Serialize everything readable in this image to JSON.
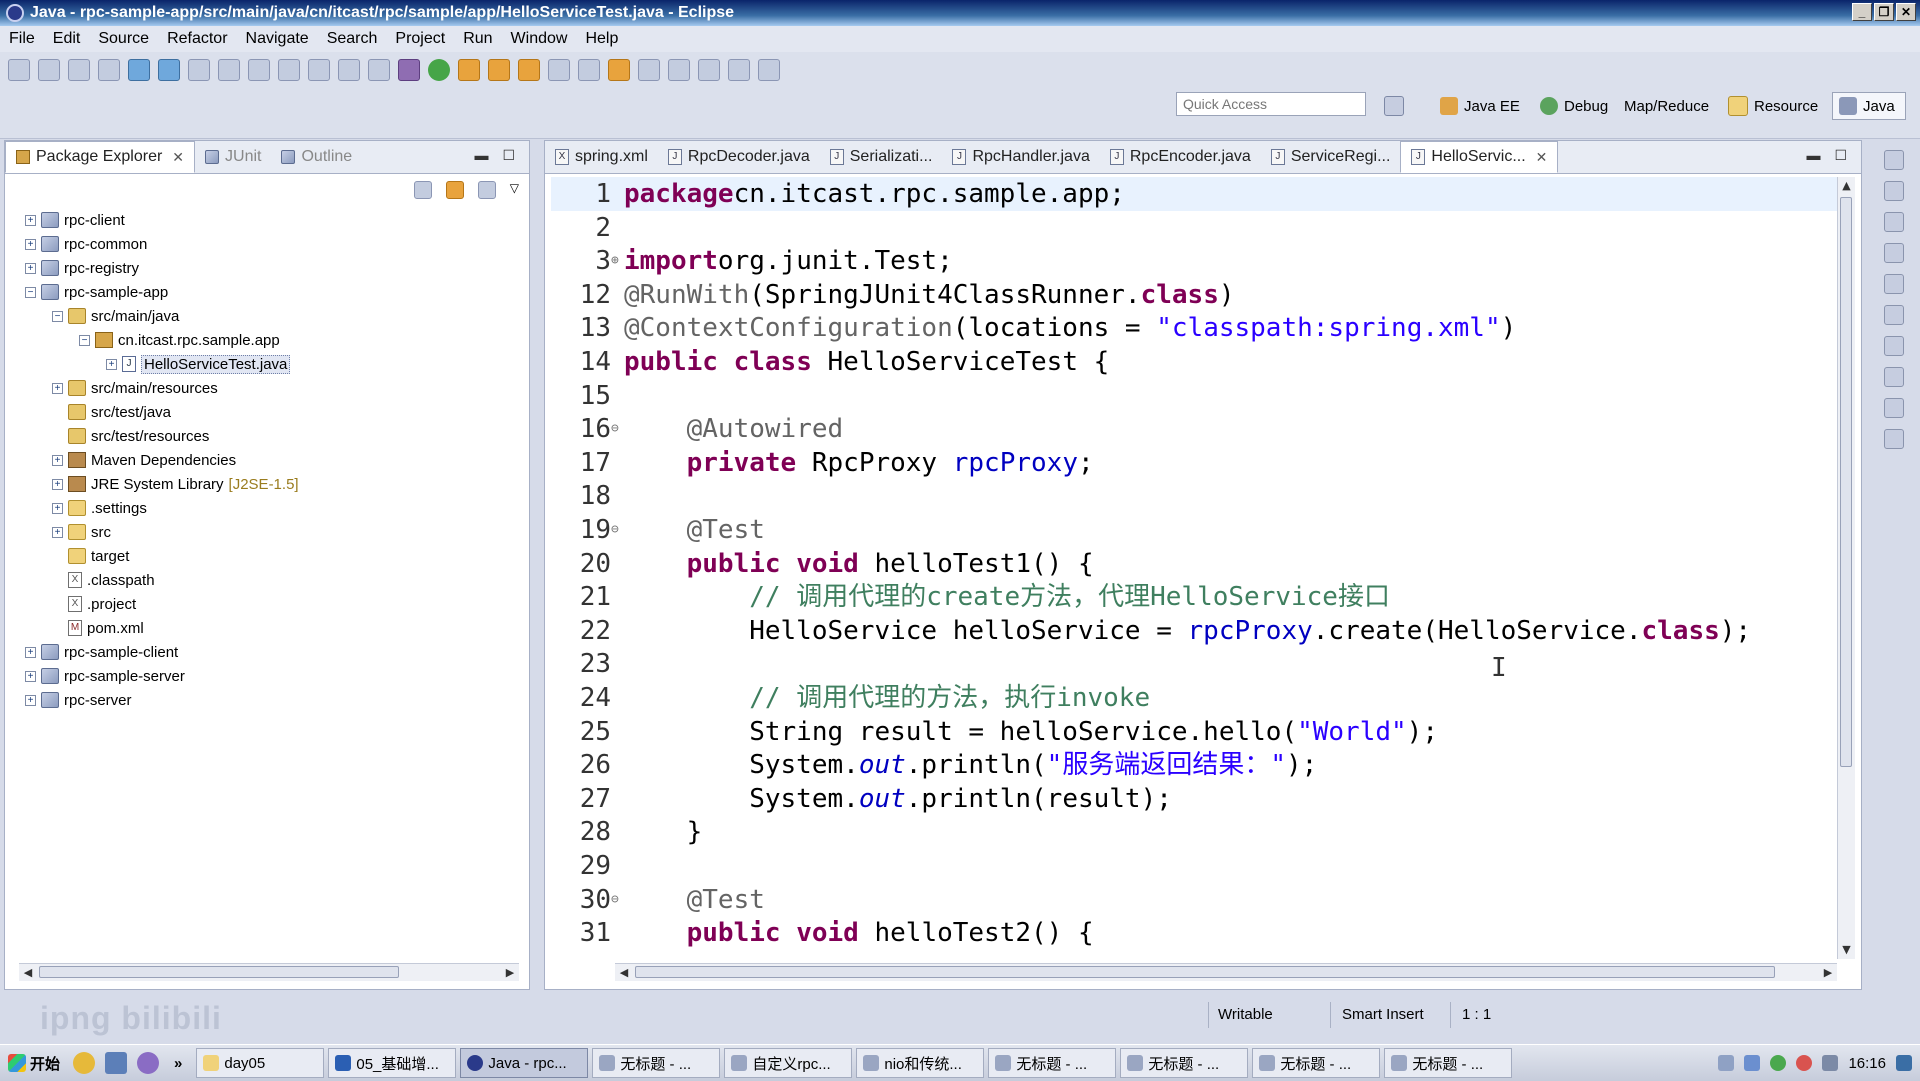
{
  "window": {
    "title": "Java - rpc-sample-app/src/main/java/cn/itcast/rpc/sample/app/HelloServiceTest.java - Eclipse",
    "buttons": [
      "_",
      "❐",
      "✕"
    ]
  },
  "menu": [
    "File",
    "Edit",
    "Source",
    "Refactor",
    "Navigate",
    "Search",
    "Project",
    "Run",
    "Window",
    "Help"
  ],
  "toolbar": {
    "quick_access_placeholder": "Quick Access",
    "perspectives": [
      "Java EE",
      "Debug",
      "Map/Reduce",
      "Resource",
      "Java"
    ]
  },
  "left_panel": {
    "tabs": [
      "Package Explorer",
      "JUnit",
      "Outline"
    ],
    "tree": [
      {
        "label": "rpc-client",
        "icon": "project-icon",
        "expander": "+"
      },
      {
        "label": "rpc-common",
        "icon": "project-icon",
        "expander": "+"
      },
      {
        "label": "rpc-registry",
        "icon": "project-icon",
        "expander": "+"
      },
      {
        "label": "rpc-sample-app",
        "icon": "project-icon",
        "expander": "−"
      },
      {
        "label": "src/main/java",
        "icon": "source-folder-icon",
        "expander": "−"
      },
      {
        "label": "cn.itcast.rpc.sample.app",
        "icon": "package-icon",
        "expander": "−"
      },
      {
        "label": "HelloServiceTest.java",
        "icon": "java-file-icon",
        "expander": "+"
      },
      {
        "label": "src/main/resources",
        "icon": "source-folder-icon",
        "expander": "+"
      },
      {
        "label": "src/test/java",
        "icon": "source-folder-icon",
        "expander": ""
      },
      {
        "label": "src/test/resources",
        "icon": "source-folder-icon",
        "expander": ""
      },
      {
        "label": "Maven Dependencies",
        "icon": "library-icon",
        "expander": "+"
      },
      {
        "label": "JRE System Library",
        "decoration": "[J2SE-1.5]",
        "icon": "library-icon",
        "expander": "+"
      },
      {
        "label": ".settings",
        "icon": "folder-icon",
        "expander": "+"
      },
      {
        "label": "src",
        "icon": "folder-icon",
        "expander": "+"
      },
      {
        "label": "target",
        "icon": "folder-icon",
        "expander": ""
      },
      {
        "label": ".classpath",
        "icon": "xml-file-icon",
        "expander": ""
      },
      {
        "label": ".project",
        "icon": "xml-file-icon",
        "expander": ""
      },
      {
        "label": "pom.xml",
        "icon": "maven-file-icon",
        "expander": ""
      },
      {
        "label": "rpc-sample-client",
        "icon": "project-icon",
        "expander": "+"
      },
      {
        "label": "rpc-sample-server",
        "icon": "project-icon",
        "expander": "+"
      },
      {
        "label": "rpc-server",
        "icon": "project-icon",
        "expander": "+"
      }
    ]
  },
  "editor": {
    "tabs": [
      {
        "label": "spring.xml",
        "icon": "X"
      },
      {
        "label": "RpcDecoder.java",
        "icon": "J"
      },
      {
        "label": "Serializati...",
        "icon": "J"
      },
      {
        "label": "RpcHandler.java",
        "icon": "J"
      },
      {
        "label": "RpcEncoder.java",
        "icon": "J"
      },
      {
        "label": "ServiceRegi...",
        "icon": "J"
      },
      {
        "label": "HelloServic...",
        "icon": "J",
        "active": true
      }
    ],
    "lines": [
      {
        "num": "1",
        "fold": "",
        "tokens": [
          [
            "kw",
            "package"
          ],
          [
            "",
            "cn.itcast.rpc.sample.app;"
          ]
        ]
      },
      {
        "num": "2",
        "fold": "",
        "tokens": []
      },
      {
        "num": "3",
        "fold": "⊕",
        "tokens": [
          [
            "kw",
            "import"
          ],
          [
            "",
            "org.junit.Test;"
          ]
        ]
      },
      {
        "num": "12",
        "fold": "",
        "tokens": [
          [
            "ann",
            "@RunWith"
          ],
          [
            "",
            "(SpringJUnit4ClassRunner."
          ],
          [
            "kw",
            "class"
          ],
          [
            "",
            ")"
          ]
        ]
      },
      {
        "num": "13",
        "fold": "",
        "tokens": [
          [
            "ann",
            "@ContextConfiguration"
          ],
          [
            "",
            "(locations = "
          ],
          [
            "str",
            "\"classpath:spring.xml\""
          ],
          [
            "",
            ")"
          ]
        ]
      },
      {
        "num": "14",
        "fold": "",
        "tokens": [
          [
            "kw",
            "public"
          ],
          [
            "",
            " "
          ],
          [
            "kw",
            "class"
          ],
          [
            "",
            " HelloServiceTest {"
          ]
        ]
      },
      {
        "num": "15",
        "fold": "",
        "tokens": []
      },
      {
        "num": "16",
        "fold": "⊖",
        "tokens": [
          [
            "",
            "    "
          ],
          [
            "ann",
            "@Autowired"
          ]
        ]
      },
      {
        "num": "17",
        "fold": "",
        "tokens": [
          [
            "",
            "    "
          ],
          [
            "kw",
            "private"
          ],
          [
            "",
            " RpcProxy "
          ],
          [
            "fld",
            "rpcProxy"
          ],
          [
            "",
            ";"
          ]
        ]
      },
      {
        "num": "18",
        "fold": "",
        "tokens": []
      },
      {
        "num": "19",
        "fold": "⊖",
        "tokens": [
          [
            "",
            "    "
          ],
          [
            "ann",
            "@Test"
          ]
        ]
      },
      {
        "num": "20",
        "fold": "",
        "tokens": [
          [
            "",
            "    "
          ],
          [
            "kw",
            "public"
          ],
          [
            "",
            " "
          ],
          [
            "kw",
            "void"
          ],
          [
            "",
            " helloTest1() {"
          ]
        ]
      },
      {
        "num": "21",
        "fold": "",
        "tokens": [
          [
            "",
            "        "
          ],
          [
            "cmt",
            "// 调用代理的create方法，代理HelloService接口"
          ]
        ]
      },
      {
        "num": "22",
        "fold": "",
        "tokens": [
          [
            "",
            "        HelloService helloService = "
          ],
          [
            "fld",
            "rpcProxy"
          ],
          [
            "",
            ".create(HelloService."
          ],
          [
            "kw",
            "class"
          ],
          [
            "",
            ");"
          ]
        ]
      },
      {
        "num": "23",
        "fold": "",
        "tokens": []
      },
      {
        "num": "24",
        "fold": "",
        "tokens": [
          [
            "",
            "        "
          ],
          [
            "cmt",
            "// 调用代理的方法，执行invoke"
          ]
        ]
      },
      {
        "num": "25",
        "fold": "",
        "tokens": [
          [
            "",
            "        String result = helloService.hello("
          ],
          [
            "str",
            "\"World\""
          ],
          [
            "",
            ");"
          ]
        ]
      },
      {
        "num": "26",
        "fold": "",
        "tokens": [
          [
            "",
            "        System."
          ],
          [
            "sfld",
            "out"
          ],
          [
            "",
            ".println("
          ],
          [
            "str",
            "\"服务端返回结果：\""
          ],
          [
            "",
            ");"
          ]
        ]
      },
      {
        "num": "27",
        "fold": "",
        "tokens": [
          [
            "",
            "        System."
          ],
          [
            "sfld",
            "out"
          ],
          [
            "",
            ".println(result);"
          ]
        ]
      },
      {
        "num": "28",
        "fold": "",
        "tokens": [
          [
            "",
            "    }"
          ]
        ]
      },
      {
        "num": "29",
        "fold": "",
        "tokens": []
      },
      {
        "num": "30",
        "fold": "⊖",
        "tokens": [
          [
            "",
            "    "
          ],
          [
            "ann",
            "@Test"
          ]
        ]
      },
      {
        "num": "31",
        "fold": "",
        "tokens": [
          [
            "",
            "    "
          ],
          [
            "kw",
            "public"
          ],
          [
            "",
            " "
          ],
          [
            "kw",
            "void"
          ],
          [
            "",
            " helloTest2() {"
          ]
        ]
      }
    ]
  },
  "status": {
    "writable": "Writable",
    "insert_mode": "Smart Insert",
    "position": "1 : 1"
  },
  "watermark": "ipng bilibili",
  "taskbar": {
    "start_label": "开始",
    "more": "»",
    "tasks": [
      {
        "label": "day05",
        "active": false
      },
      {
        "label": "05_基础增...",
        "active": false
      },
      {
        "label": "Java - rpc...",
        "active": true
      },
      {
        "label": "无标题 - ...",
        "active": false
      },
      {
        "label": "自定义rpc...",
        "active": false
      },
      {
        "label": "nio和传统...",
        "active": false
      },
      {
        "label": "无标题 - ...",
        "active": false
      },
      {
        "label": "无标题 - ...",
        "active": false
      },
      {
        "label": "无标题 - ...",
        "active": false
      },
      {
        "label": "无标题 - ...",
        "active": false
      }
    ],
    "clock": "16:16"
  }
}
